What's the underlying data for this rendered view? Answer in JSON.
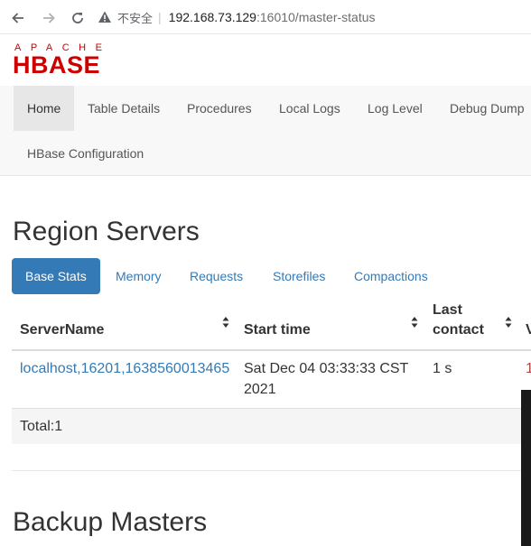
{
  "browser": {
    "security_label": "不安全",
    "url_host": "192.168.73.129",
    "url_rest": ":16010/master-status"
  },
  "logo": {
    "top_text": "APACHE",
    "main_text": "HBASE",
    "color": "#cc0000"
  },
  "navbar": {
    "items": [
      {
        "label": "Home",
        "active": true
      },
      {
        "label": "Table Details"
      },
      {
        "label": "Procedures"
      },
      {
        "label": "Local Logs"
      },
      {
        "label": "Log Level"
      },
      {
        "label": "Debug Dump"
      },
      {
        "label": "HBase Configuration"
      }
    ]
  },
  "region_servers": {
    "title": "Region Servers",
    "tabs": [
      {
        "label": "Base Stats",
        "active": true
      },
      {
        "label": "Memory"
      },
      {
        "label": "Requests"
      },
      {
        "label": "Storefiles"
      },
      {
        "label": "Compactions"
      }
    ],
    "table": {
      "headers": [
        "ServerName",
        "Start time",
        "Last contact",
        "V"
      ],
      "last_contact_line1": "Last",
      "last_contact_line2": "contact",
      "rows": [
        {
          "server_name": "localhost,16201,1638560013465",
          "start_time_line1": "Sat Dec 04 03:33:33 CST",
          "start_time_line2": "2021",
          "last_contact": "1 s",
          "version_partial": "1"
        }
      ],
      "total": "Total:1"
    }
  },
  "backup_masters": {
    "title": "Backup Masters"
  },
  "colors": {
    "accent": "#337ab7",
    "brand_red": "#cc0000"
  }
}
